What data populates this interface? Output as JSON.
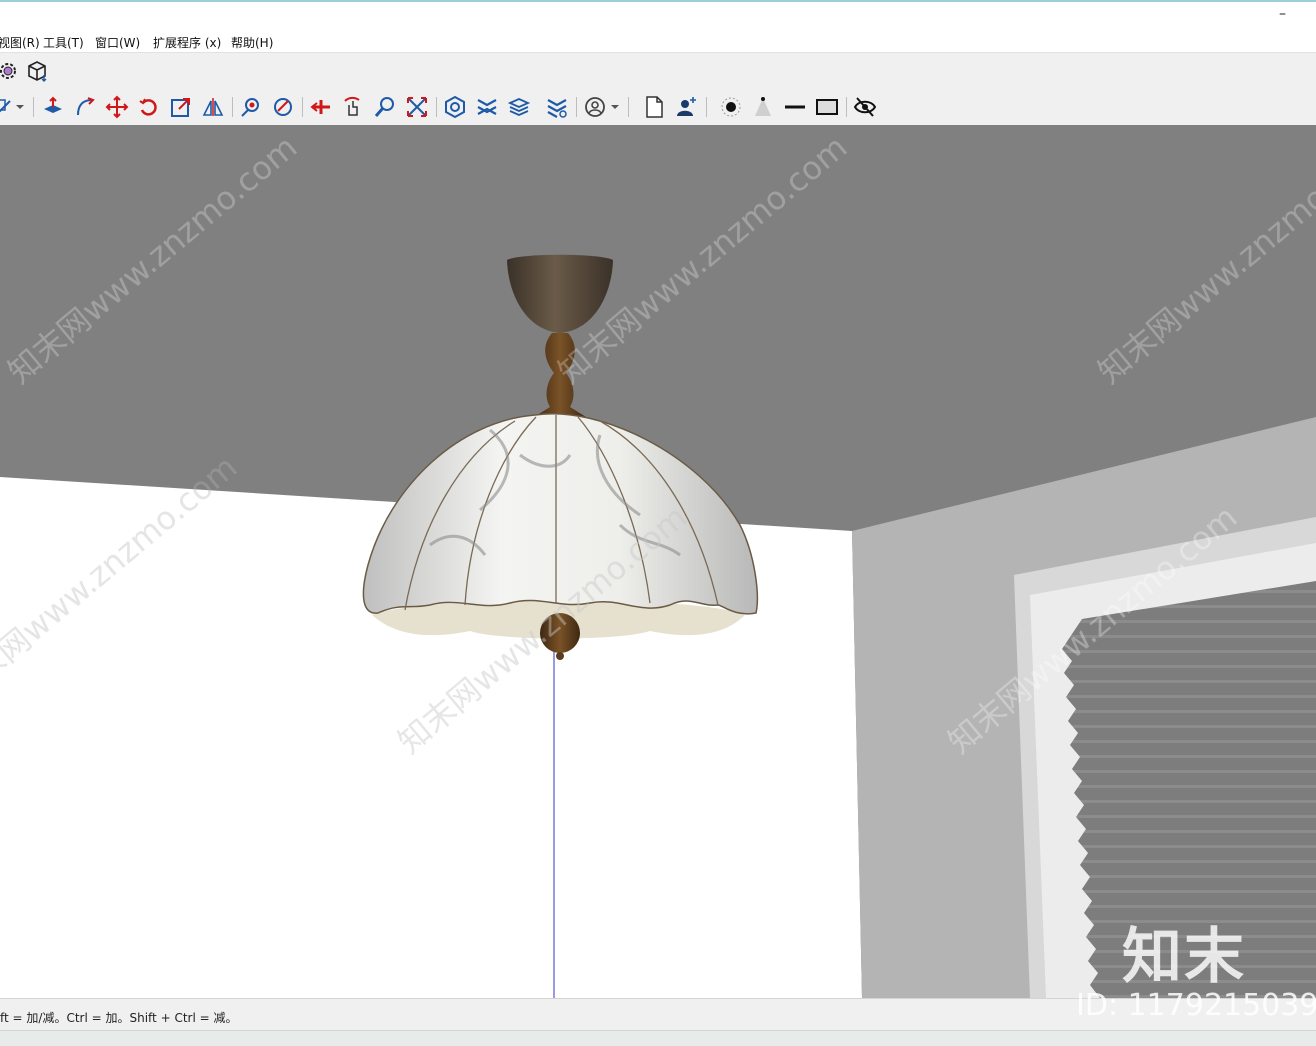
{
  "menu": {
    "items": [
      {
        "label": "视图(R)"
      },
      {
        "label": "工具(T)"
      },
      {
        "label": "窗口(W)"
      },
      {
        "label": "扩展程序 (x)"
      },
      {
        "label": "帮助(H)"
      }
    ]
  },
  "window": {
    "minimize_glyph": "–"
  },
  "toolbar1": {
    "icons": [
      "gear-icon",
      "component-icon"
    ]
  },
  "toolbar2": {
    "icons": [
      "pencil-icon",
      "dropdown-arrow-icon",
      "push-pull-icon",
      "follow-me-icon",
      "move-icon",
      "rotate-icon",
      "scale-icon",
      "flip-icon",
      "orbit-icon",
      "pan-icon",
      "walk-icon",
      "look-around-icon",
      "zoom-icon",
      "zoom-extents-icon",
      "layers-icon",
      "solid-tools-icon",
      "sandbox-icon",
      "stack-icon",
      "account-icon",
      "new-page-icon",
      "user-add-icon",
      "point-icon",
      "cone-icon",
      "line-icon",
      "rectangle-icon",
      "hide-icon"
    ]
  },
  "status": {
    "hint": "ft = 加/减。Ctrl = 加。Shift + Ctrl = 减。"
  },
  "watermark": {
    "brand": "知末",
    "id_text": "ID: 1179215039",
    "diagonal": "知末网www.znzmo.com"
  },
  "colors": {
    "ceiling": "#808080",
    "wall_left": "#ffffff",
    "wall_right": "#b3b3b3",
    "axis": "#3434c8",
    "lamp_wood": "#5a3c20",
    "accent_red": "#d01818",
    "accent_blue": "#1e5aa8"
  }
}
